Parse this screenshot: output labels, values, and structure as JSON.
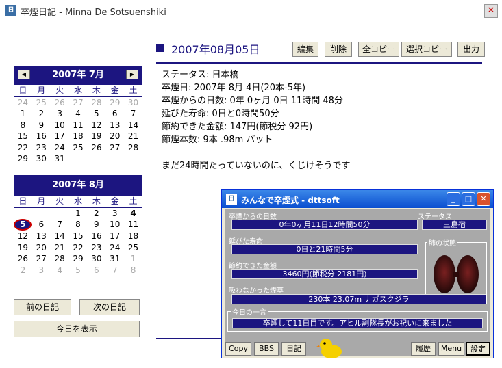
{
  "window": {
    "title": "卒煙日記 - Minna De Sotsuenshiki",
    "icon_text": "日"
  },
  "header": {
    "date": "2007年08月05日"
  },
  "toolbar": {
    "edit": "編集",
    "delete": "削除",
    "copy_all": "全コピー",
    "copy_sel": "選択コピー",
    "output": "出力"
  },
  "diary": {
    "lines": [
      "ステータス: 日本橋",
      "卒煙日: 2007年 8月 4日(20本-5年)",
      "卒煙からの日数: 0年 0ヶ月 0日 11時間 48分",
      "延びた寿命: 0日と0時間50分",
      "節約できた金額: 147円(節税分 92円)",
      "節煙本数: 9本 .98m バット"
    ],
    "message": "まだ24時間たっていないのに、くじけそうです"
  },
  "calendar_july": {
    "title": "2007年 7月",
    "prev": "◀",
    "next": "▶",
    "dow": [
      "日",
      "月",
      "火",
      "水",
      "木",
      "金",
      "土"
    ],
    "rows": [
      [
        "24",
        "25",
        "26",
        "27",
        "28",
        "29",
        "30"
      ],
      [
        "1",
        "2",
        "3",
        "4",
        "5",
        "6",
        "7"
      ],
      [
        "8",
        "9",
        "10",
        "11",
        "12",
        "13",
        "14"
      ],
      [
        "15",
        "16",
        "17",
        "18",
        "19",
        "20",
        "21"
      ],
      [
        "22",
        "23",
        "24",
        "25",
        "26",
        "27",
        "28"
      ],
      [
        "29",
        "30",
        "31",
        "",
        "",
        "",
        ""
      ]
    ]
  },
  "calendar_august": {
    "title": "2007年 8月",
    "dow": [
      "日",
      "月",
      "火",
      "水",
      "木",
      "金",
      "土"
    ],
    "rows": [
      [
        "",
        "",
        "",
        "1",
        "2",
        "3",
        "4"
      ],
      [
        "5",
        "6",
        "7",
        "8",
        "9",
        "10",
        "11"
      ],
      [
        "12",
        "13",
        "14",
        "15",
        "16",
        "17",
        "18"
      ],
      [
        "19",
        "20",
        "21",
        "22",
        "23",
        "24",
        "25"
      ],
      [
        "26",
        "27",
        "28",
        "29",
        "30",
        "31",
        "1"
      ],
      [
        "2",
        "3",
        "4",
        "5",
        "6",
        "7",
        "8"
      ]
    ]
  },
  "nav": {
    "prev_diary": "前の日記",
    "next_diary": "次の日記",
    "show_today": "今日を表示"
  },
  "widget": {
    "title": "みんなで卒煙式 - dttsoft",
    "days_label": "卒煙からの日数",
    "days_value": "0年0ヶ月11日12時間50分",
    "status_label": "ステータス",
    "status_value": "三島宿",
    "life_label": "延びた寿命",
    "life_value": "0日と21時間5分",
    "lung_label": "肺の状態",
    "saved_label": "節約できた金額",
    "saved_value": "3460円(節税分 2181円)",
    "cig_label": "吸わなかった煙草",
    "cig_value": "230本 23.07m ナガスクジラ",
    "word_label": "今日の一言",
    "word_value": "卒煙して11日目です。アヒル副隊長がお祝いに来ました",
    "copy": "Copy",
    "bbs": "BBS",
    "diary": "日記",
    "history": "履歴",
    "menu": "Menu",
    "settings": "設定"
  },
  "colors": {
    "accent": "#1c1580",
    "widget_title": "#0a4ed0",
    "today_ring": "#cc0000"
  }
}
